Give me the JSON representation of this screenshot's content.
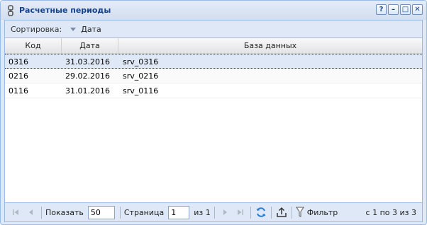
{
  "window": {
    "title": "Расчетные периоды",
    "tools": [
      "?",
      "–",
      "□",
      "✕"
    ]
  },
  "sortbar": {
    "label": "Сортировка:",
    "field": "Дата"
  },
  "grid": {
    "columns": [
      "Код",
      "Дата",
      "База данных"
    ],
    "rows": [
      {
        "code": "0316",
        "date": "31.03.2016",
        "db": "srv_0316"
      },
      {
        "code": "0216",
        "date": "29.02.2016",
        "db": "srv_0216"
      },
      {
        "code": "0116",
        "date": "31.01.2016",
        "db": "srv_0116"
      }
    ],
    "selected_row": 0
  },
  "pager": {
    "show_label": "Показать",
    "page_size": "50",
    "page_label": "Страница",
    "page": "1",
    "of_label": "из 1",
    "filter_label": "Фильтр",
    "count_text": "с 1 по 3 из 3"
  },
  "colors": {
    "title": "#15428b",
    "panel_bg": "#dfe8f6",
    "border": "#99bbe8",
    "refresh_icon": "#2a7fd4"
  }
}
